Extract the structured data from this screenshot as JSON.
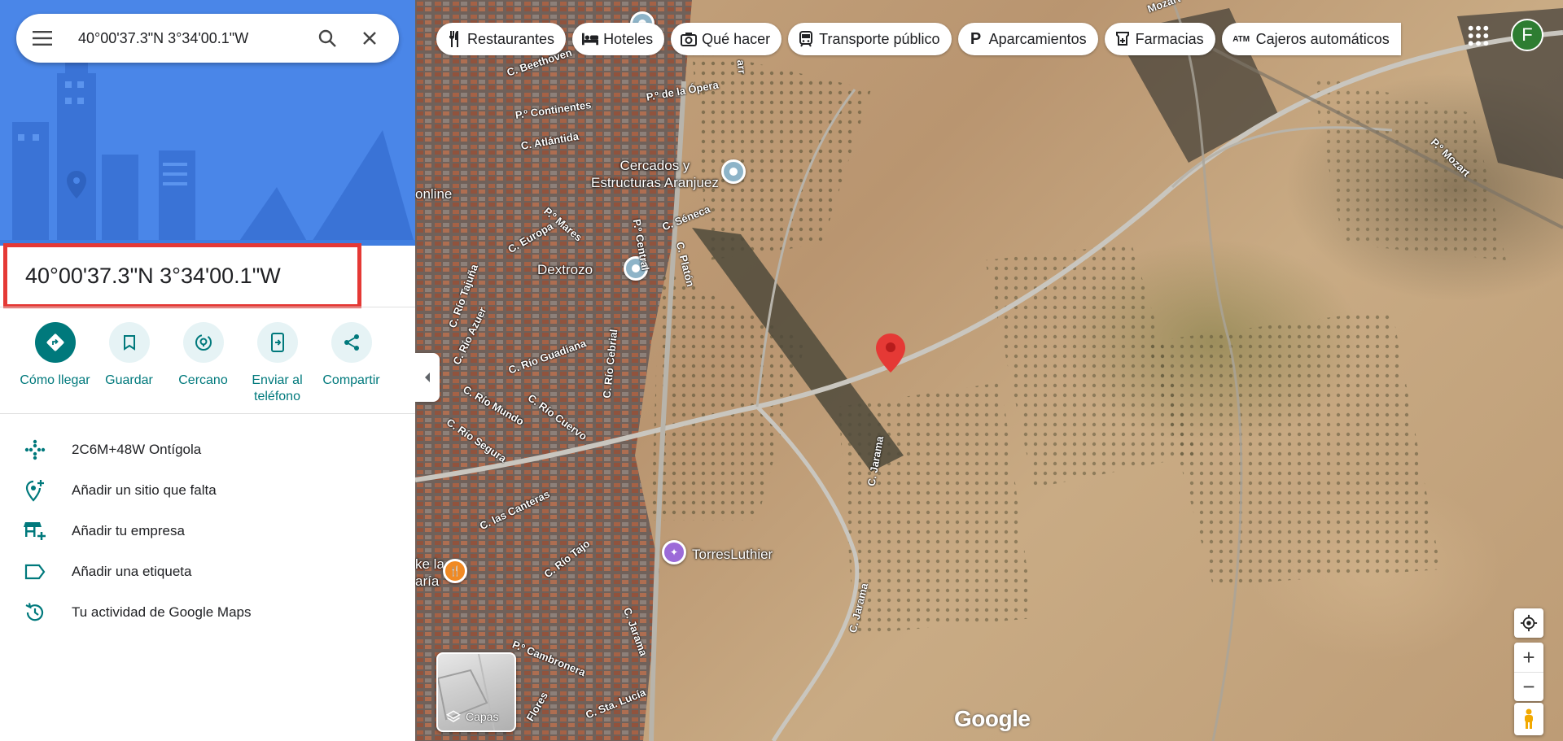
{
  "search": {
    "query": "40°00'37.3\"N 3°34'00.1\"W"
  },
  "place": {
    "title": "40°00'37.3\"N 3°34'00.1\"W"
  },
  "actions": [
    {
      "label": "Cómo llegar",
      "icon": "directions-icon"
    },
    {
      "label": "Guardar",
      "icon": "bookmark-icon"
    },
    {
      "label": "Cercano",
      "icon": "nearby-icon"
    },
    {
      "label": "Enviar al teléfono",
      "icon": "send-to-phone-icon"
    },
    {
      "label": "Compartir",
      "icon": "share-icon"
    }
  ],
  "info": [
    {
      "text": "2C6M+48W Ontígola",
      "icon": "plus-code-icon"
    },
    {
      "text": "Añadir un sitio que falta",
      "icon": "add-place-icon"
    },
    {
      "text": "Añadir tu empresa",
      "icon": "add-business-icon"
    },
    {
      "text": "Añadir una etiqueta",
      "icon": "label-icon"
    },
    {
      "text": "Tu actividad de Google Maps",
      "icon": "history-icon"
    }
  ],
  "chips": [
    {
      "label": "Restaurantes",
      "icon": "restaurant-icon"
    },
    {
      "label": "Hoteles",
      "icon": "hotel-icon"
    },
    {
      "label": "Qué hacer",
      "icon": "camera-icon"
    },
    {
      "label": "Transporte público",
      "icon": "transit-icon"
    },
    {
      "label": "Aparcamientos",
      "icon": "parking-icon"
    },
    {
      "label": "Farmacias",
      "icon": "pharmacy-icon"
    },
    {
      "label": "Cajeros automáticos",
      "icon": "atm-icon"
    }
  ],
  "user": {
    "initial": "F"
  },
  "map": {
    "places": {
      "cercados": "Cercados y\nEstructuras Aranjuez",
      "dextrozo": "Dextrozo",
      "torres": "TorresLuthier",
      "online": "online",
      "ke_la": "ke la\naría"
    },
    "streets": {
      "beethoven": "C. Beethoven",
      "opera": "P.º de la Ópera",
      "continentes": "P.º Continentes",
      "atlantida": "C. Atlántida",
      "seneca": "C. Séneca",
      "platon": "C. Platón",
      "central": "P.º Central",
      "europa": "C. Europa",
      "mares": "P.º Mares",
      "tajuna": "C. Río Tajuña",
      "azuer": "C. Río Azuer",
      "guadiana": "C. Río Guadiana",
      "cebrial": "C. Río Cebrial",
      "mundo": "C. Río Mundo",
      "cuervo": "C. Río Cuervo",
      "segura": "C. Río Segura",
      "canteras": "C. las Canteras",
      "tajo": "C. Río Tajo",
      "jarama1": "C. Jarama",
      "jarama2": "C. Jarama",
      "jarama3": "C. Jarama",
      "cambronera": "P.º Cambronera",
      "flores": "Flores",
      "sta_lucia": "C. Sta. Lucía",
      "mozart": "P.º Mozart",
      "mozart_top": "Mozart",
      "arr": "arr"
    },
    "layers_label": "Capas",
    "brand": "Google"
  },
  "colors": {
    "accent": "#00797c",
    "hero": "#4a86e8",
    "pin": "#e53935",
    "avatar": "#2e7d32"
  }
}
